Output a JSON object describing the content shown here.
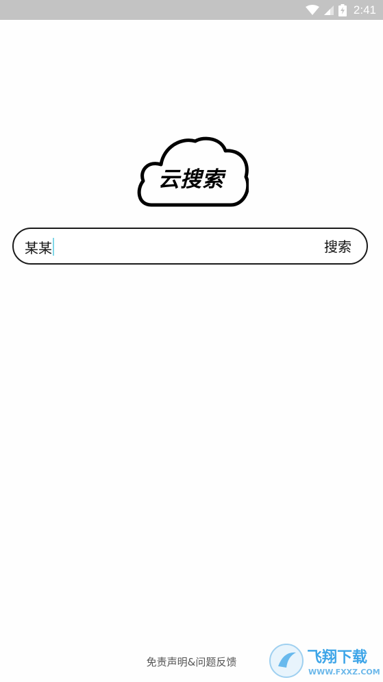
{
  "status_bar": {
    "time": "2:41",
    "icons": [
      "wifi-icon",
      "cell-signal-icon",
      "battery-icon"
    ],
    "background": "#c3c3c3"
  },
  "logo": {
    "text": "云搜索",
    "icon": "cloud-logo"
  },
  "search": {
    "value": "某某",
    "button_label": "搜索",
    "caret_color": "#7fd6e6"
  },
  "footer": {
    "link_label": "免责声明&问题反馈"
  },
  "watermark": {
    "title": "飞翔下载",
    "url": "WWW.FXXZ.COM",
    "accent": "#3da5e8"
  }
}
